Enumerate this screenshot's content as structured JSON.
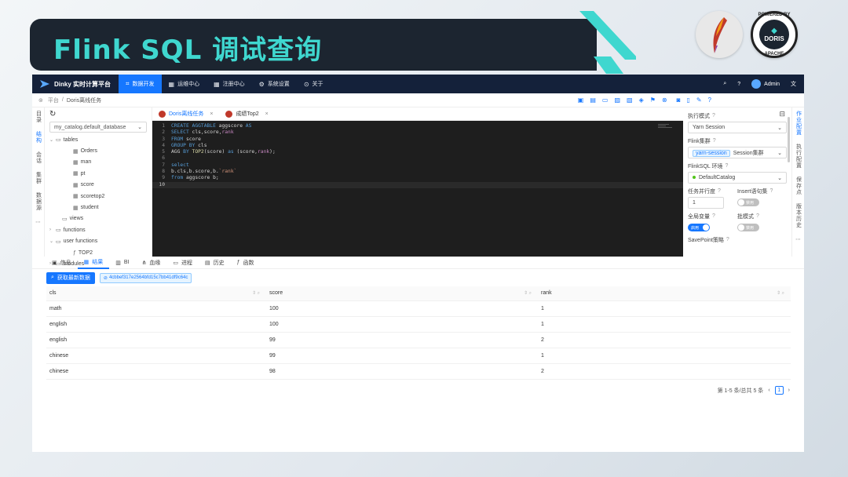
{
  "slide": {
    "title": "Flink SQL 调试查询",
    "doris_badge_top": "POWERED BY",
    "doris_badge_bottom": "APACHE",
    "doris_badge_center": "DORIS"
  },
  "app": {
    "brand": "Dinky 实时计算平台",
    "nav": [
      {
        "label": "数据开发",
        "icon": "code-icon",
        "active": true
      },
      {
        "label": "运维中心",
        "icon": "grid-icon"
      },
      {
        "label": "注册中心",
        "icon": "grid-icon"
      },
      {
        "label": "系统设置",
        "icon": "gear-icon"
      },
      {
        "label": "关于",
        "icon": "info-icon"
      }
    ],
    "user": "Admin",
    "breadcrumb": [
      "平台",
      "Doris离线任务"
    ],
    "left_vtabs": [
      "目录",
      "结构",
      "会话",
      "集群",
      "数据源"
    ],
    "right_vtabs": [
      "作业配置",
      "执行配置",
      "保存点",
      "版本历史"
    ],
    "catalog_select": "my_catalog.default_database",
    "tree": [
      {
        "label": "tables",
        "level": 1,
        "caret": "v",
        "type": "folder"
      },
      {
        "label": "Orders",
        "level": 3,
        "type": "table"
      },
      {
        "label": "man",
        "level": 3,
        "type": "table"
      },
      {
        "label": "pt",
        "level": 3,
        "type": "table"
      },
      {
        "label": "score",
        "level": 3,
        "type": "table"
      },
      {
        "label": "scoretop2",
        "level": 3,
        "type": "table"
      },
      {
        "label": "student",
        "level": 3,
        "type": "table"
      },
      {
        "label": "views",
        "level": 2,
        "type": "folder"
      },
      {
        "label": "functions",
        "level": 1,
        "caret": ">",
        "type": "folder"
      },
      {
        "label": "user functions",
        "level": 1,
        "caret": "v",
        "type": "folder"
      },
      {
        "label": "TOP2",
        "level": 3,
        "type": "function"
      },
      {
        "label": "modules",
        "level": 1,
        "caret": ">",
        "type": "folder"
      }
    ],
    "editor_tabs": [
      {
        "label": "Doris离线任务",
        "active": true
      },
      {
        "label": "成绩Top2",
        "active": false
      }
    ],
    "code_lines": [
      {
        "n": "1",
        "tokens": [
          [
            "kw",
            "CREATE AGGTABLE "
          ],
          [
            "tx",
            "aggscore "
          ],
          [
            "kw",
            "AS"
          ]
        ]
      },
      {
        "n": "2",
        "tokens": [
          [
            "kw",
            "SELECT "
          ],
          [
            "tx",
            "cls,score,"
          ],
          [
            "pk",
            "rank"
          ]
        ]
      },
      {
        "n": "3",
        "tokens": [
          [
            "kw",
            "FROM "
          ],
          [
            "tx",
            "score"
          ]
        ]
      },
      {
        "n": "4",
        "tokens": [
          [
            "kw",
            "GROUP BY "
          ],
          [
            "tx",
            "cls"
          ]
        ]
      },
      {
        "n": "5",
        "tokens": [
          [
            "tx",
            "AGG "
          ],
          [
            "kw",
            "BY "
          ],
          [
            "fn",
            "TOP2"
          ],
          [
            "tx",
            "(score) "
          ],
          [
            "kw",
            "as "
          ],
          [
            "tx",
            "(score,"
          ],
          [
            "pk",
            "rank"
          ],
          [
            "tx",
            ");"
          ]
        ]
      },
      {
        "n": "6",
        "tokens": []
      },
      {
        "n": "7",
        "tokens": [
          [
            "kw",
            "select"
          ]
        ]
      },
      {
        "n": "8",
        "tokens": [
          [
            "tx",
            "b.cls,b.score,b."
          ],
          [
            "st",
            "`rank`"
          ]
        ]
      },
      {
        "n": "9",
        "tokens": [
          [
            "kw",
            "from "
          ],
          [
            "tx",
            "aggscore b;"
          ]
        ]
      },
      {
        "n": "10",
        "tokens": [],
        "current": true
      }
    ],
    "props": {
      "exec_mode_label": "执行模式",
      "exec_mode_value": "Yarn Session",
      "cluster_label": "Flink集群",
      "cluster_tag": "yarn-session",
      "cluster_value": "Session集群",
      "env_label": "FlinkSQL 环境",
      "env_value": "DefaultCatalog",
      "parallelism_label": "任务并行度",
      "parallelism_value": "1",
      "insert_label": "Insert语句集",
      "insert_switch": "禁用",
      "global_var_label": "全局变量",
      "global_var_switch": "启用",
      "batch_label": "批模式",
      "batch_switch": "禁用",
      "savepoint_label": "SavePoint策略"
    },
    "result_tabs": [
      {
        "label": "信息",
        "icon": "info-icon"
      },
      {
        "label": "结果",
        "icon": "table-icon",
        "active": true
      },
      {
        "label": "BI",
        "icon": "bar-chart-icon"
      },
      {
        "label": "血缘",
        "icon": "lineage-icon"
      },
      {
        "label": "进程",
        "icon": "monitor-icon"
      },
      {
        "label": "历史",
        "icon": "history-icon"
      },
      {
        "label": "函数",
        "icon": "function-icon"
      }
    ],
    "fetch_button": "获取最新数据",
    "job_id": "4cbbef317e2564bfd15c7bb41df9c64c",
    "table": {
      "columns": [
        "cls",
        "score",
        "rank"
      ],
      "rows": [
        [
          "math",
          "100",
          "1"
        ],
        [
          "english",
          "100",
          "1"
        ],
        [
          "english",
          "99",
          "2"
        ],
        [
          "chinese",
          "99",
          "1"
        ],
        [
          "chinese",
          "98",
          "2"
        ]
      ]
    },
    "pagination": {
      "summary": "第 1-5 条/总共 5 条",
      "current_page": "1"
    }
  },
  "colors": {
    "accent": "#1677ff",
    "nav_bg": "#14213a",
    "title_color": "#3fd7cf",
    "header_bg": "#1c2530"
  }
}
